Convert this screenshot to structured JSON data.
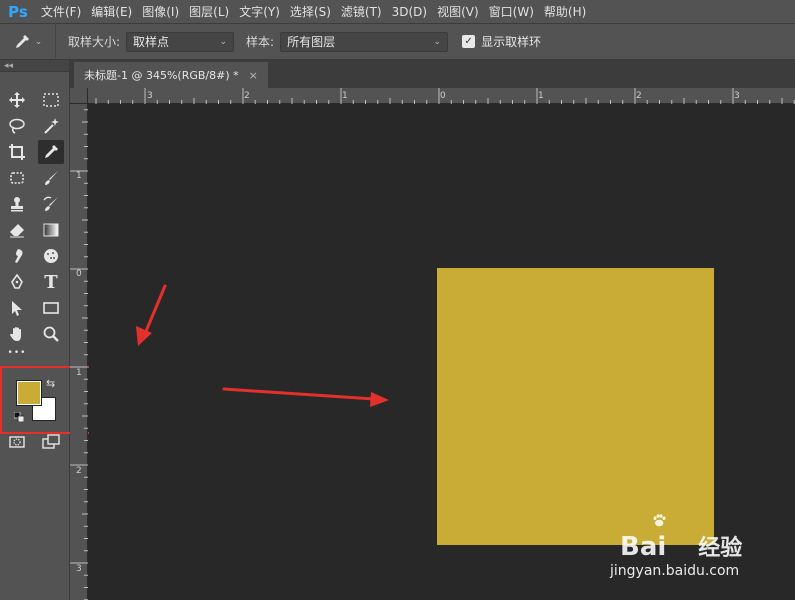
{
  "app": {
    "logo": "Ps"
  },
  "menu": [
    "文件(F)",
    "编辑(E)",
    "图像(I)",
    "图层(L)",
    "文字(Y)",
    "选择(S)",
    "滤镜(T)",
    "3D(D)",
    "视图(V)",
    "窗口(W)",
    "帮助(H)"
  ],
  "options": {
    "sample_size_label": "取样大小:",
    "sample_size_value": "取样点",
    "sample_label": "样本:",
    "sample_value": "所有图层",
    "show_ring_label": "显示取样环",
    "show_ring_checked": true
  },
  "document": {
    "tab_title": "未标题-1 @ 345%(RGB/8#) *",
    "close_glyph": "×",
    "fill_color": "#c8ac36"
  },
  "rulers": {
    "horizontal_labels": [
      "3",
      "2",
      "1",
      "0",
      "1",
      "2",
      "3"
    ],
    "vertical_labels": [
      "1",
      "0",
      "1",
      "2",
      "3"
    ]
  },
  "colors": {
    "foreground": "#c9ac36",
    "background": "#ffffff",
    "highlight": "#e4302c"
  },
  "toolbar": {
    "tools": [
      "move-icon",
      "marquee-icon",
      "lasso-icon",
      "magic-wand-icon",
      "crop-icon",
      "eyedropper-icon",
      "patch-icon",
      "brush-icon",
      "stamp-icon",
      "history-brush-icon",
      "eraser-icon",
      "gradient-icon",
      "smudge-icon",
      "sponge-icon",
      "pen-icon",
      "type-icon",
      "path-select-icon",
      "rectangle-icon",
      "hand-icon",
      "zoom-icon",
      "more-icon",
      "quick-mask-icon",
      "screen-mode-icon"
    ],
    "type_glyph": "T",
    "more_glyph": "•••"
  },
  "watermark": {
    "brand": "Bai",
    "brand_tail": "经验",
    "url": "jingyan.baidu.com"
  }
}
